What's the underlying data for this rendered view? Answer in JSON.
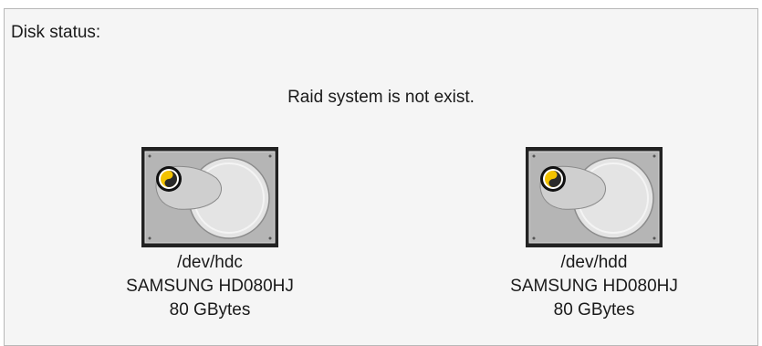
{
  "panel": {
    "title": "Disk status:",
    "raid_message": "Raid system is not exist."
  },
  "disks": [
    {
      "device": "/dev/hdc",
      "model": "SAMSUNG HD080HJ",
      "capacity": "80 GBytes",
      "icon": "hard-disk-icon"
    },
    {
      "device": "/dev/hdd",
      "model": "SAMSUNG HD080HJ",
      "capacity": "80 GBytes",
      "icon": "hard-disk-icon"
    }
  ],
  "colors": {
    "panel_background": "#f5f5f5",
    "panel_border": "#b8b8b8",
    "disk_body": "#b5b5b5",
    "disk_platter": "#e0e0e0",
    "disk_frame": "#222222",
    "led": "#f2c200"
  }
}
